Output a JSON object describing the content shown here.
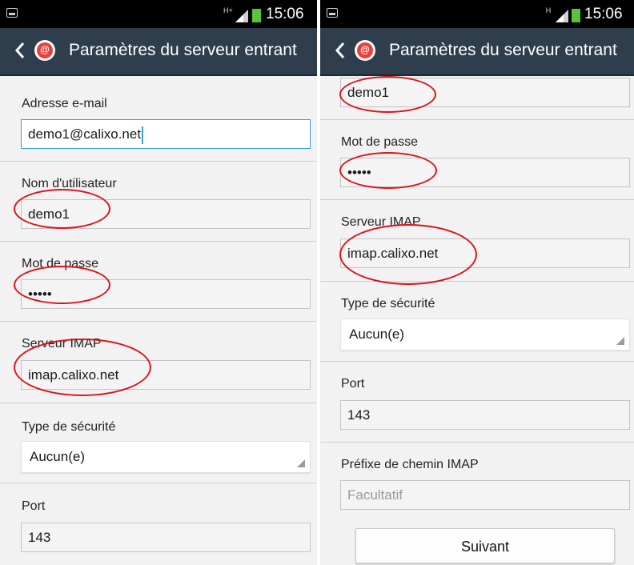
{
  "colors": {
    "status_bar": "#000000",
    "action_bar": "#2f3e4c",
    "background": "#f2f2f2",
    "active_field_border": "#3a9edb",
    "annotation": "#d9141a",
    "battery": "#55c53a",
    "app_icon": "#e8413d"
  },
  "left": {
    "status": {
      "network_label": "H+",
      "time": "15:06"
    },
    "actionbar": {
      "title": "Paramètres du serveur entrant",
      "app_icon": "at-sign-icon"
    },
    "email": {
      "label": "Adresse e-mail",
      "value": "demo1@calixo.net"
    },
    "username": {
      "label": "Nom d'utilisateur",
      "value": "demo1"
    },
    "password": {
      "label": "Mot de passe",
      "value": "•••••"
    },
    "server": {
      "label": "Serveur IMAP",
      "value": "imap.calixo.net"
    },
    "security": {
      "label": "Type de sécurité",
      "value": "Aucun(e)"
    },
    "port": {
      "label": "Port",
      "value": "143"
    }
  },
  "right": {
    "status": {
      "network_label": "H",
      "time": "15:06"
    },
    "actionbar": {
      "title": "Paramètres du serveur entrant",
      "app_icon": "at-sign-icon"
    },
    "username": {
      "value": "demo1"
    },
    "password": {
      "label": "Mot de passe",
      "value": "•••••"
    },
    "server": {
      "label": "Serveur IMAP",
      "value": "imap.calixo.net"
    },
    "security": {
      "label": "Type de sécurité",
      "value": "Aucun(e)"
    },
    "port": {
      "label": "Port",
      "value": "143"
    },
    "prefix": {
      "label": "Préfixe de chemin IMAP",
      "placeholder": "Facultatif"
    },
    "next_label": "Suivant"
  }
}
